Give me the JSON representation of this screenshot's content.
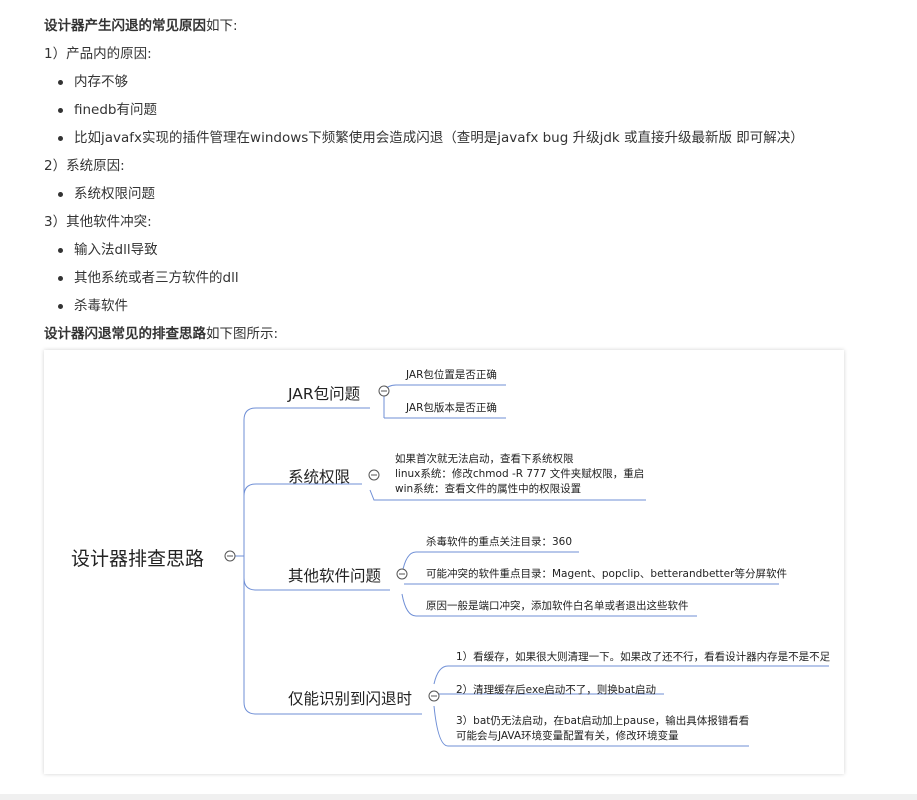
{
  "intro": {
    "strong": "设计器产生闪退的常见原因",
    "tail": "如下:"
  },
  "sections": [
    {
      "heading": "1）产品内的原因:",
      "items": [
        "内存不够",
        "finedb有问题",
        "比如javafx实现的插件管理在windows下频繁使用会造成闪退（查明是javafx bug 升级jdk 或直接升级最新版 即可解决）"
      ]
    },
    {
      "heading": "2）系统原因:",
      "items": [
        "系统权限问题"
      ]
    },
    {
      "heading": "3）其他软件冲突:",
      "items": [
        "输入法dll导致",
        "其他系统或者三方软件的dll",
        "杀毒软件"
      ]
    }
  ],
  "diagram_intro": {
    "strong": "设计器闪退常见的排查思路",
    "tail": "如下图所示:"
  },
  "mindmap": {
    "root": "设计器排查思路",
    "branches": [
      {
        "label": "JAR包问题",
        "leaves": [
          "JAR包位置是否正确",
          "JAR包版本是否正确"
        ]
      },
      {
        "label": "系统权限",
        "leaves": [
          "如果首次就无法启动，查看下系统权限",
          "linux系统：修改chmod -R 777 文件夹赋权限，重启",
          "win系统：查看文件的属性中的权限设置"
        ]
      },
      {
        "label": "其他软件问题",
        "leaves": [
          "杀毒软件的重点关注目录：360",
          "可能冲突的软件重点目录：Magent、popclip、betterandbetter等分屏软件",
          "原因一般是端口冲突，添加软件白名单或者退出这些软件"
        ]
      },
      {
        "label": "仅能识别到闪退时",
        "leaves": [
          "1）看缓存，如果很大则清理一下。如果改了还不行，看看设计器内存是不是不足",
          "2）清理缓存后exe启动不了，则换bat启动",
          "3）bat仍无法启动，在bat启动加上pause，输出具体报错看看",
          "可能会与JAVA环境变量配置有关，修改环境变量"
        ]
      }
    ],
    "line_color": "#6f8fd6"
  }
}
